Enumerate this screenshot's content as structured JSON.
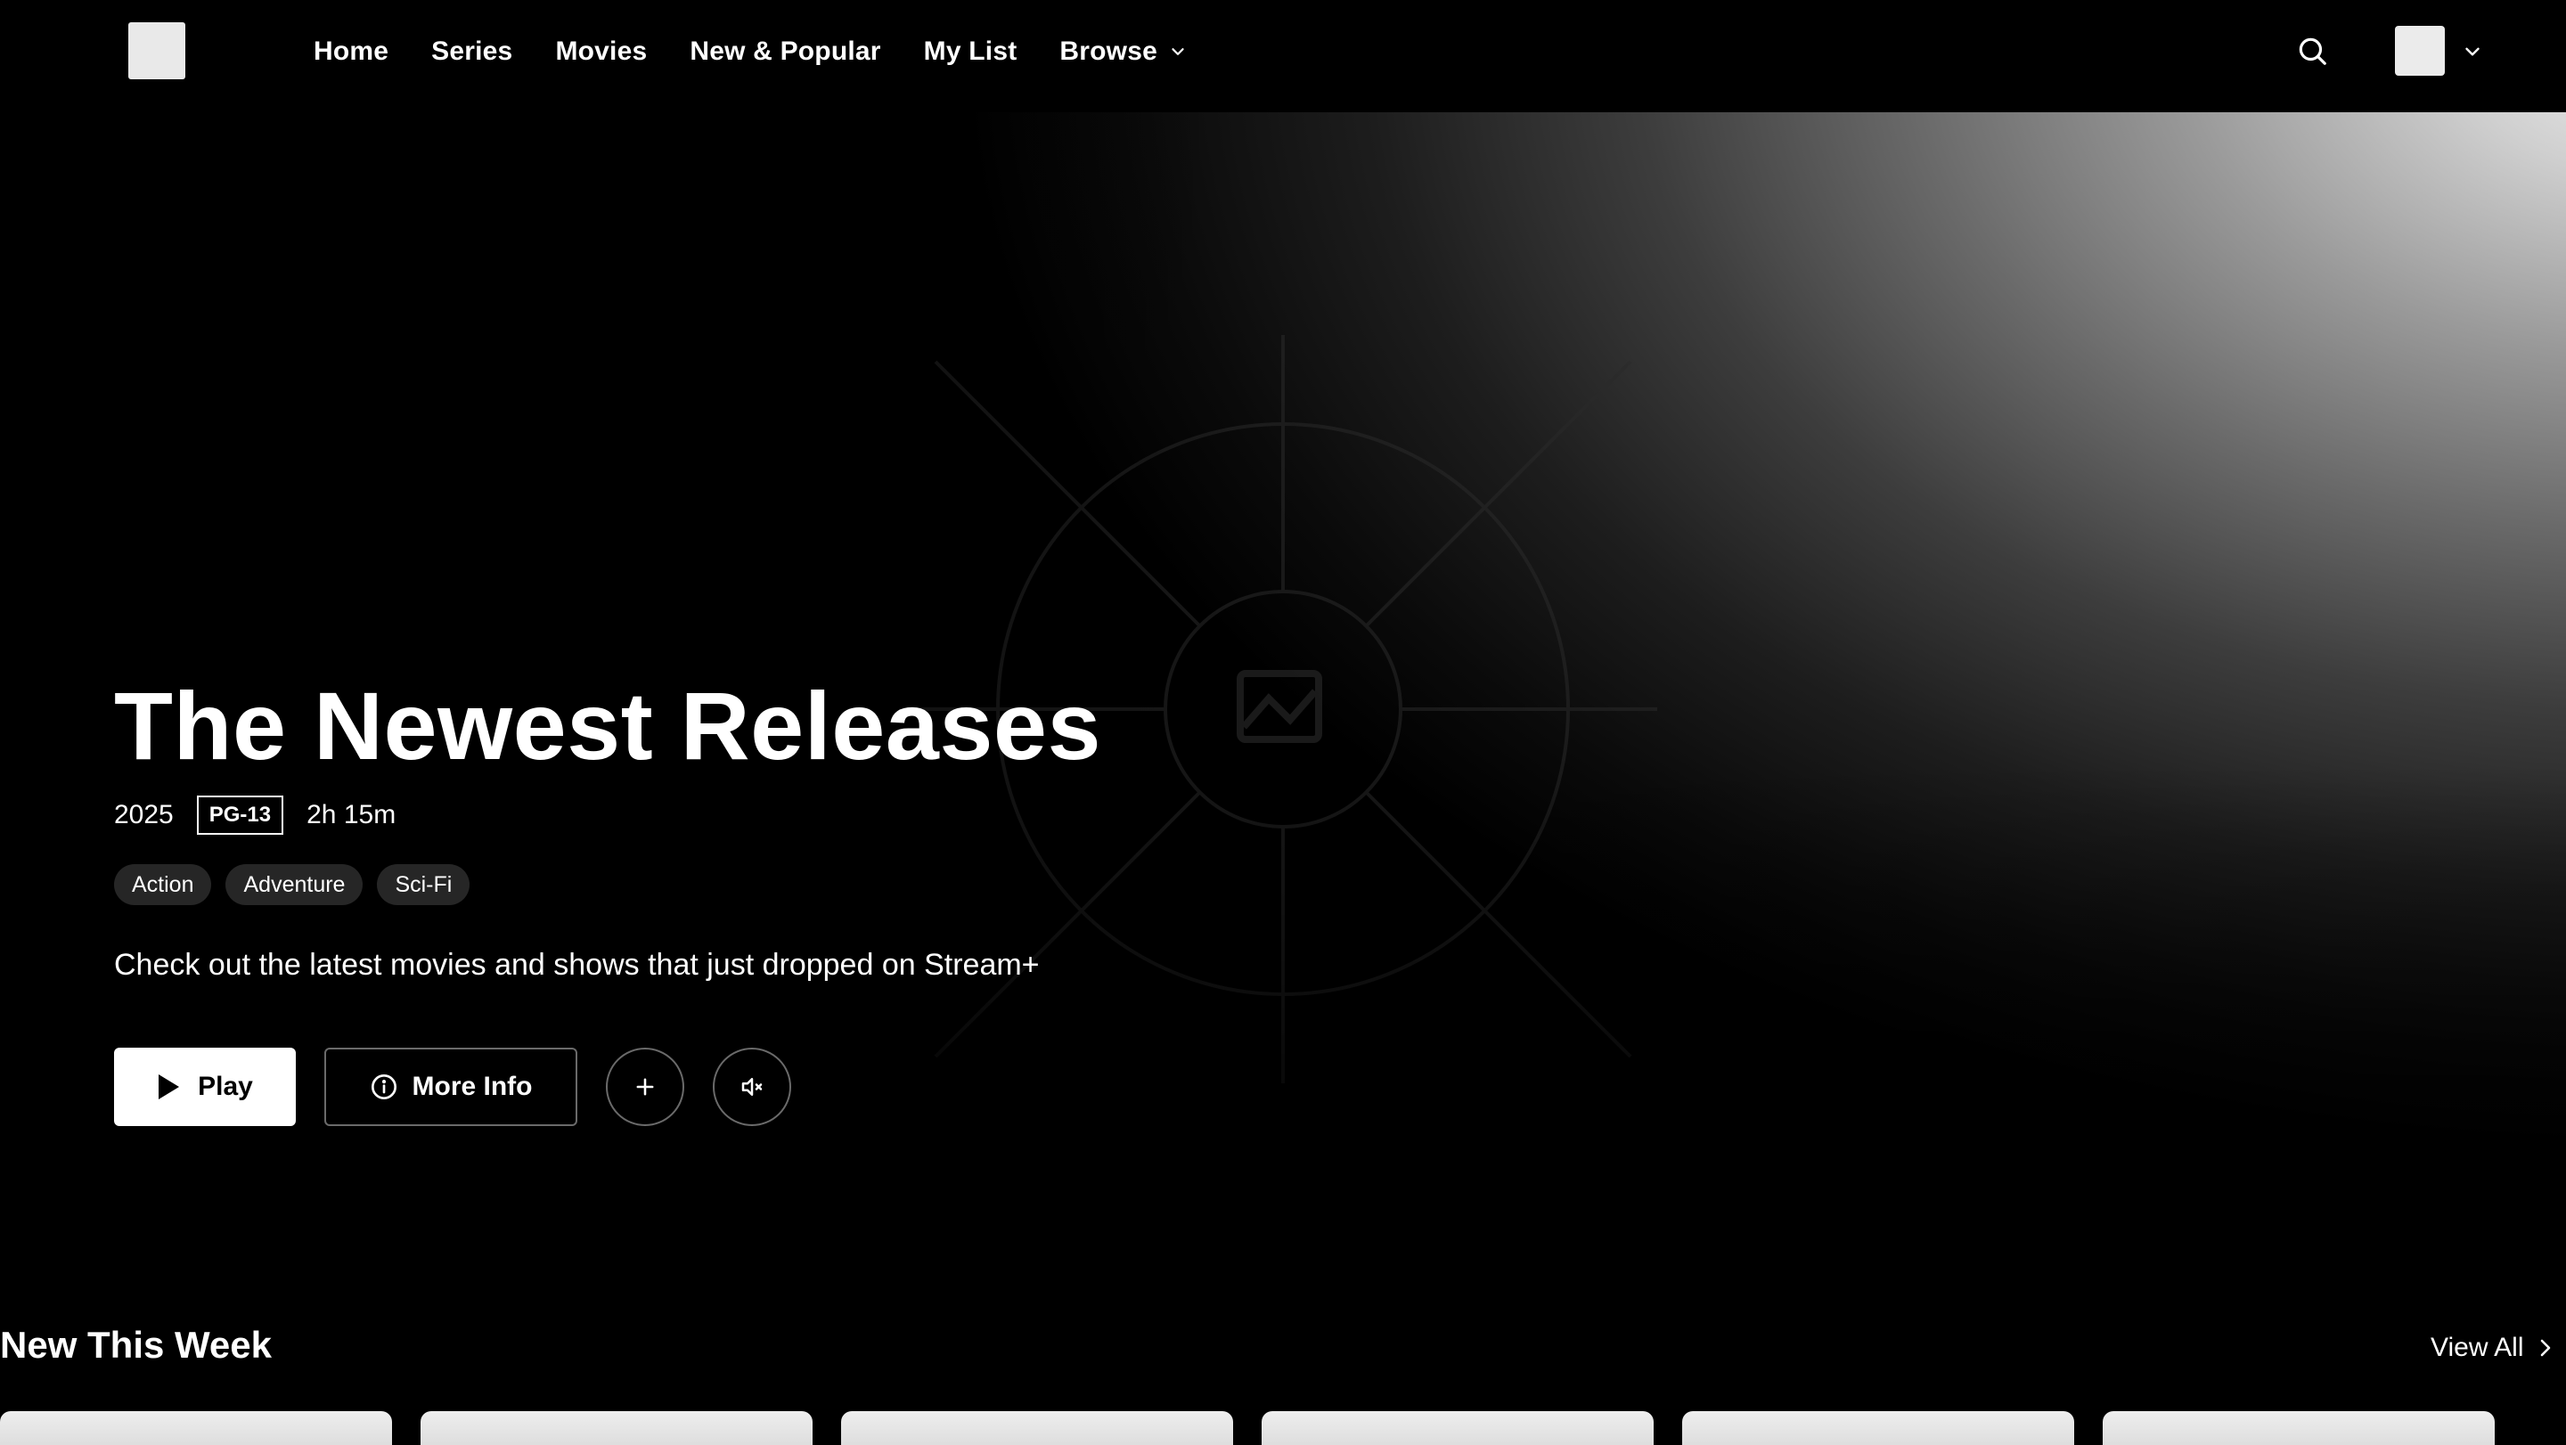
{
  "nav": {
    "links": [
      {
        "label": "Home"
      },
      {
        "label": "Series"
      },
      {
        "label": "Movies"
      },
      {
        "label": "New & Popular"
      },
      {
        "label": "My List"
      },
      {
        "label": "Browse"
      }
    ]
  },
  "hero": {
    "title": "The Newest Releases",
    "year": "2025",
    "rating": "PG-13",
    "duration": "2h 15m",
    "genres": [
      "Action",
      "Adventure",
      "Sci-Fi"
    ],
    "description": "Check out the latest movies and shows that just dropped on Stream+",
    "play_label": "Play",
    "info_label": "More Info"
  },
  "row": {
    "title": "New This Week",
    "view_all": "View All"
  },
  "icons": {
    "search": "search-icon",
    "browse_chevron": "chevron-down-icon",
    "play": "play-icon",
    "info": "info-icon",
    "add": "plus-icon",
    "mute": "volume-mute-icon"
  }
}
